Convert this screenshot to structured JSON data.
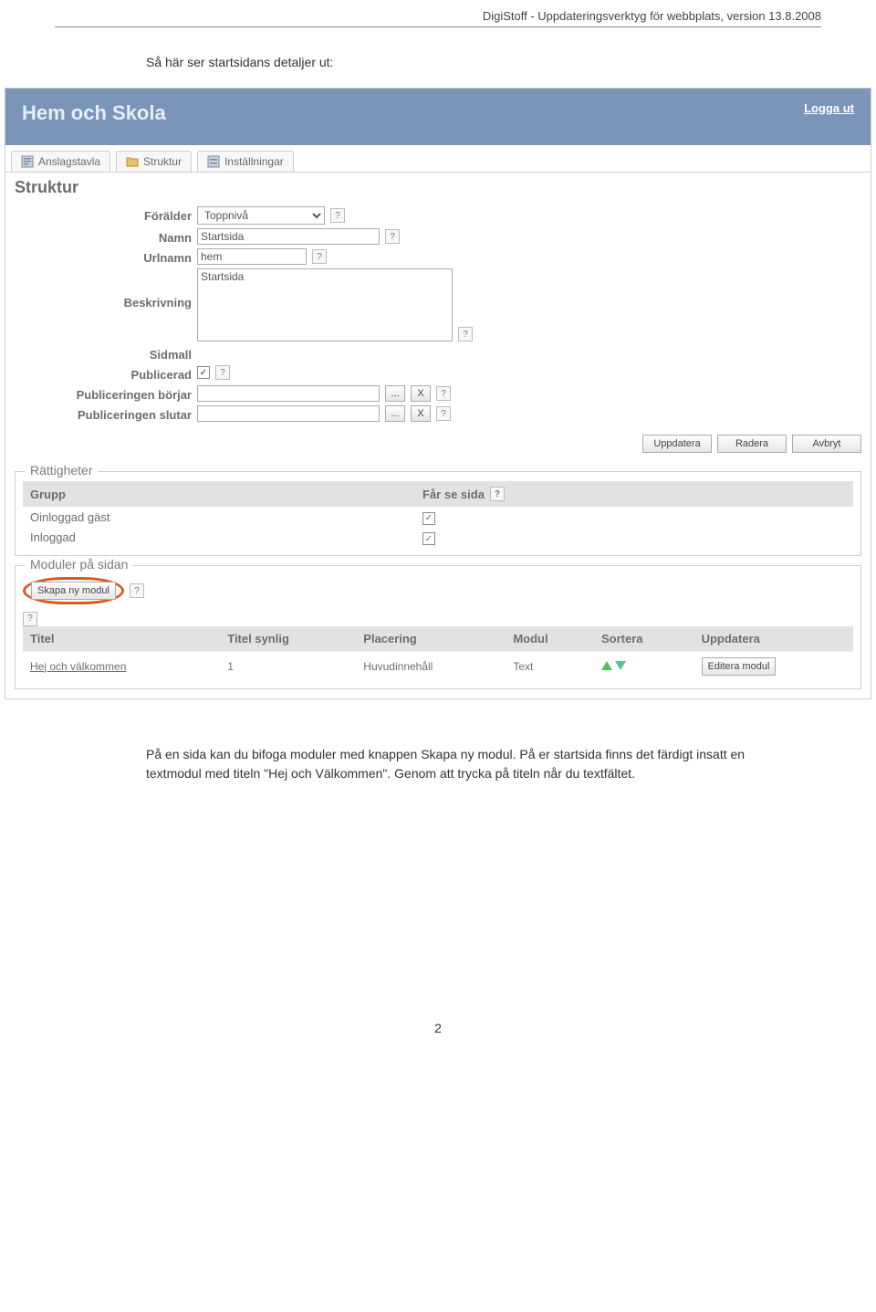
{
  "doc": {
    "header": "DigiStoff - Uppdateringsverktyg för webbplats, version 13.8.2008",
    "intro": "Så här ser startsidans detaljer ut:",
    "footer_para": "På en sida kan du bifoga moduler med knappen Skapa ny modul. På er startsida finns det färdigt insatt en textmodul med titeln \"Hej och Välkommen\". Genom att trycka på titeln når du textfältet.",
    "page_number": "2"
  },
  "banner": {
    "title": "Hem och Skola",
    "logout": "Logga ut"
  },
  "tabs": [
    {
      "label": "Anslagstavla"
    },
    {
      "label": "Struktur"
    },
    {
      "label": "Inställningar"
    }
  ],
  "section": {
    "title": "Struktur"
  },
  "form": {
    "parent_label": "Förälder",
    "parent_value": "Toppnivå",
    "name_label": "Namn",
    "name_value": "Startsida",
    "urlname_label": "Urlnamn",
    "urlname_value": "hem",
    "desc_label": "Beskrivning",
    "desc_value": "Startsida",
    "template_label": "Sidmall",
    "published_label": "Publicerad",
    "pubstart_label": "Publiceringen börjar",
    "pubend_label": "Publiceringen slutar",
    "ellipsis_btn": "...",
    "x_btn": "X"
  },
  "actions": {
    "update": "Uppdatera",
    "delete": "Radera",
    "cancel": "Avbryt"
  },
  "permissions": {
    "legend": "Rättigheter",
    "group_header": "Grupp",
    "see_header": "Får se sida",
    "rows": [
      {
        "name": "Oinloggad gäst",
        "checked": true
      },
      {
        "name": "Inloggad",
        "checked": true
      }
    ]
  },
  "modules": {
    "legend": "Moduler på sidan",
    "create_btn": "Skapa ny modul",
    "columns": {
      "title": "Titel",
      "title_visible": "Titel synlig",
      "placement": "Placering",
      "module": "Modul",
      "sort": "Sortera",
      "update": "Uppdatera"
    },
    "rows": [
      {
        "title": "Hej och välkommen",
        "title_visible": "1",
        "placement": "Huvudinnehåll",
        "module": "Text",
        "edit_btn": "Editera modul"
      }
    ]
  },
  "help_icon": "?"
}
